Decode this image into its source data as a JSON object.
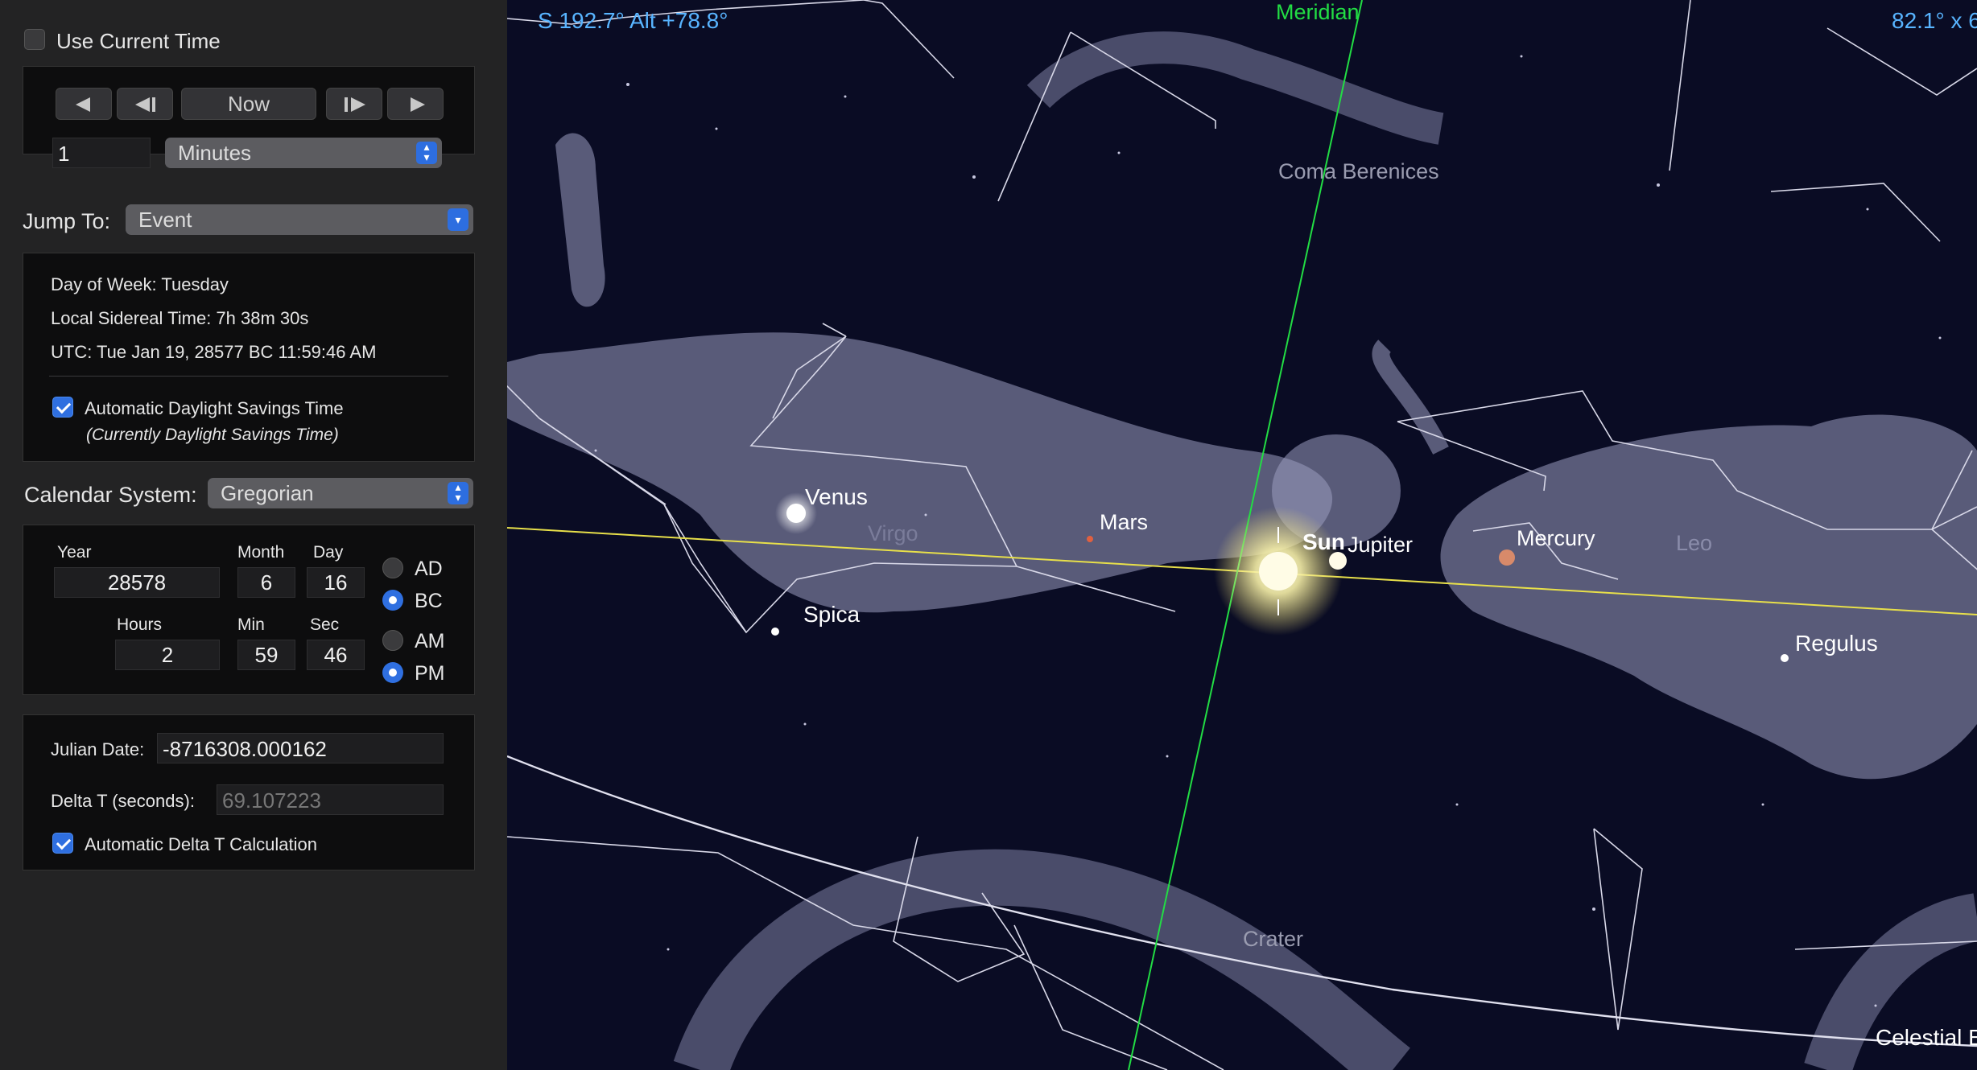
{
  "panel": {
    "use_current_time": "Use Current Time",
    "now_label": "Now",
    "step_value": "1",
    "step_unit": "Minutes",
    "jump_to_label": "Jump To:",
    "jump_to_value": "Event",
    "info": {
      "day_of_week": "Day of Week:  Tuesday",
      "sidereal": "Local Sidereal Time:  7h 38m 30s",
      "utc": "UTC:  Tue Jan 19, 28577 BC 11:59:46 AM",
      "dst_label": "Automatic Daylight Savings Time",
      "dst_note": "(Currently Daylight Savings Time)"
    },
    "calendar_label": "Calendar System:",
    "calendar_value": "Gregorian",
    "date": {
      "year_label": "Year",
      "month_label": "Month",
      "day_label": "Day",
      "year": "28578",
      "month": "6",
      "day": "16",
      "hours_label": "Hours",
      "min_label": "Min",
      "sec_label": "Sec",
      "hours": "2",
      "min": "59",
      "sec": "46",
      "ad": "AD",
      "bc": "BC",
      "am": "AM",
      "pm": "PM"
    },
    "julian_label": "Julian Date:",
    "julian_value": "-8716308.000162",
    "delta_t_label": "Delta T (seconds):",
    "delta_t_value": "69.107223",
    "auto_delta_label": "Automatic Delta T Calculation"
  },
  "sky": {
    "direction": "S 192.7° Alt +78.8°",
    "fov": "82.1° x 6",
    "meridian": "Meridian",
    "coma": "Coma Berenices",
    "venus": "Venus",
    "virgo": "Virgo",
    "mars": "Mars",
    "sun": "Sun",
    "jupiter": "Jupiter",
    "mercury": "Mercury",
    "leo": "Leo",
    "regulus": "Regulus",
    "spica": "Spica",
    "crater": "Crater",
    "celestial": "Celestial E"
  },
  "colors": {
    "sky_bg": "#0a0c24",
    "accent": "#2f6fe0",
    "meridian": "#22dd44",
    "ecliptic": "#e8e04a",
    "hud_text": "#58b4ff"
  }
}
